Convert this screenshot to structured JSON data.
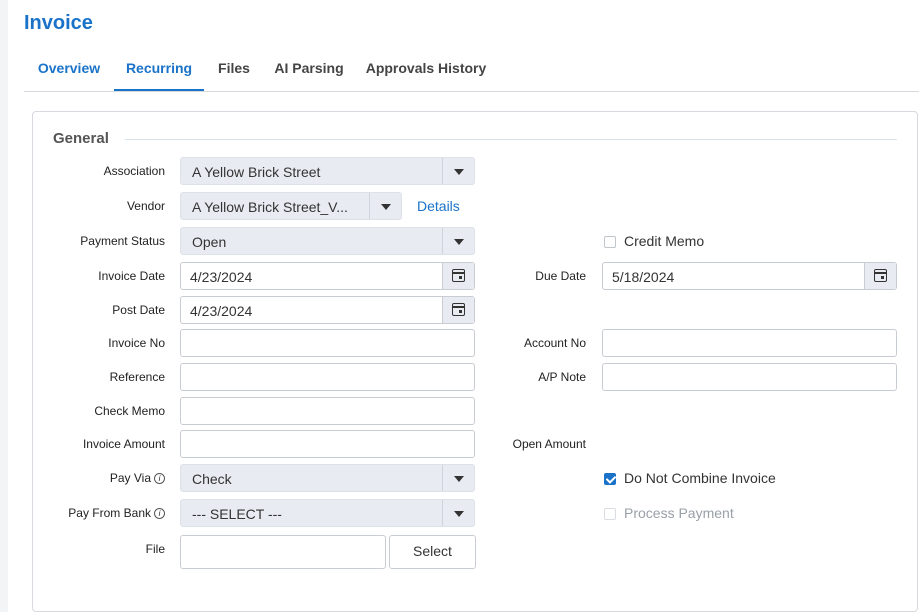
{
  "page": {
    "title": "Invoice"
  },
  "tabs": [
    {
      "label": "Overview"
    },
    {
      "label": "Recurring"
    },
    {
      "label": "Files"
    },
    {
      "label": "AI Parsing"
    },
    {
      "label": "Approvals History"
    }
  ],
  "section": {
    "title": "General"
  },
  "fields": {
    "association": {
      "label": "Association",
      "value": "A Yellow Brick Street"
    },
    "vendor": {
      "label": "Vendor",
      "value": "A Yellow Brick Street_V...",
      "details_link": "Details"
    },
    "payment_status": {
      "label": "Payment Status",
      "value": "Open"
    },
    "credit_memo": {
      "label": "Credit Memo",
      "checked": false
    },
    "invoice_date": {
      "label": "Invoice Date",
      "value": "4/23/2024"
    },
    "due_date": {
      "label": "Due Date",
      "value": "5/18/2024"
    },
    "post_date": {
      "label": "Post Date",
      "value": "4/23/2024"
    },
    "invoice_no": {
      "label": "Invoice No",
      "value": ""
    },
    "account_no": {
      "label": "Account No",
      "value": ""
    },
    "reference": {
      "label": "Reference",
      "value": ""
    },
    "ap_note": {
      "label": "A/P Note",
      "value": ""
    },
    "check_memo": {
      "label": "Check Memo",
      "value": ""
    },
    "invoice_amount": {
      "label": "Invoice Amount",
      "value": ""
    },
    "open_amount": {
      "label": "Open Amount",
      "value": ""
    },
    "pay_via": {
      "label": "Pay Via",
      "value": "Check"
    },
    "do_not_combine": {
      "label": "Do Not Combine Invoice",
      "checked": true
    },
    "pay_from_bank": {
      "label": "Pay From Bank",
      "value": "--- SELECT ---"
    },
    "process_payment": {
      "label": "Process Payment",
      "checked": false,
      "disabled": true
    },
    "file": {
      "label": "File",
      "value": "",
      "button_label": "Select"
    }
  },
  "icons": {
    "info": "info-icon",
    "calendar": "calendar-icon",
    "caret": "chevron-down-icon"
  },
  "colors": {
    "accent": "#1a73c8",
    "select_bg": "#e8ebf2"
  }
}
